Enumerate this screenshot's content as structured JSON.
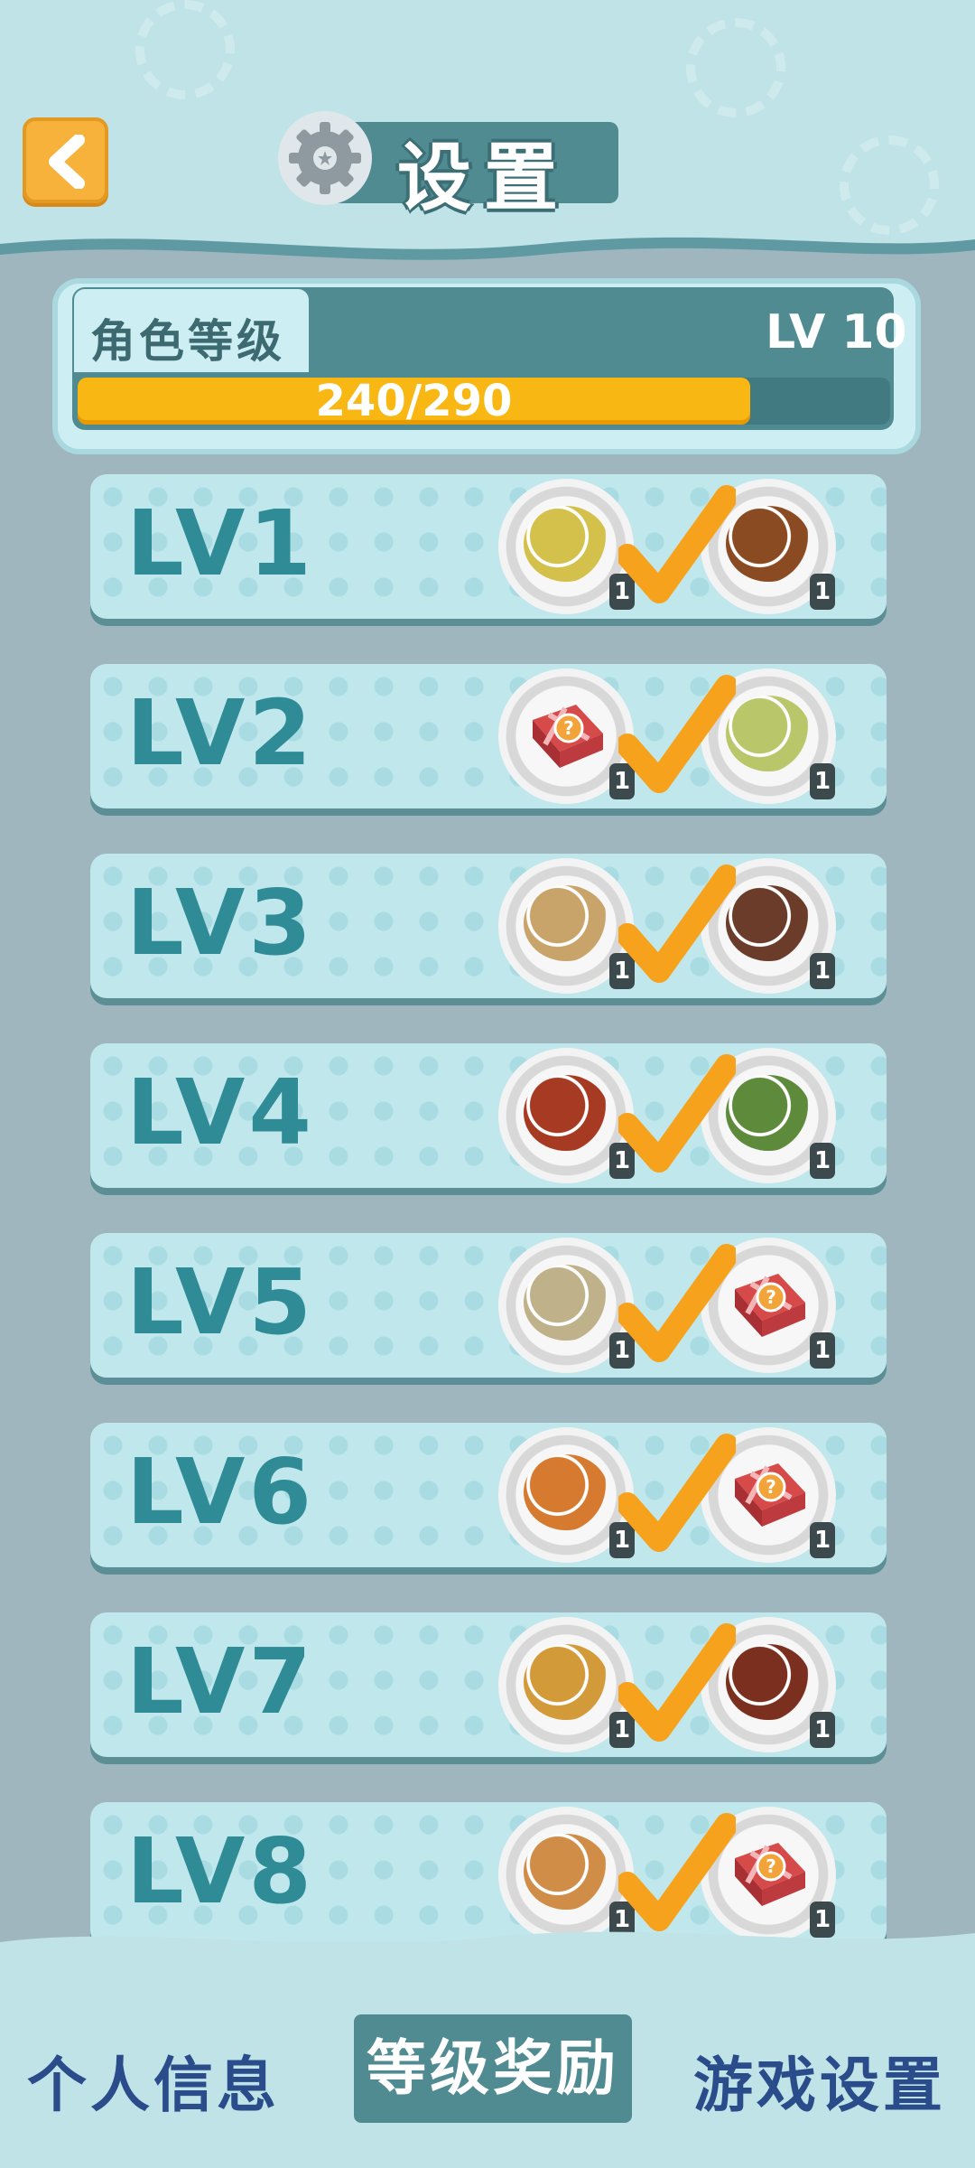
{
  "header": {
    "back_icon": "chevron-left-icon",
    "gear_icon": "gear-icon",
    "title": "设置"
  },
  "level": {
    "role_label": "角色等级",
    "level_text": "LV 10",
    "progress_text": "240/290",
    "progress_fraction": 0.8276
  },
  "rewards": [
    {
      "label": "LV1",
      "left": {
        "kind": "dish",
        "color": "#d4c14b",
        "count": "1"
      },
      "right": {
        "kind": "dish",
        "color": "#8a4a22",
        "count": "1"
      }
    },
    {
      "label": "LV2",
      "left": {
        "kind": "gift",
        "count": "1"
      },
      "right": {
        "kind": "dish",
        "color": "#b9c66a",
        "count": "1"
      }
    },
    {
      "label": "LV3",
      "left": {
        "kind": "dish",
        "color": "#c9a46a",
        "count": "1"
      },
      "right": {
        "kind": "dish",
        "color": "#6b3c2a",
        "count": "1"
      }
    },
    {
      "label": "LV4",
      "left": {
        "kind": "dish",
        "color": "#a63a22",
        "count": "1"
      },
      "right": {
        "kind": "dish",
        "color": "#5e8a3c",
        "count": "1"
      }
    },
    {
      "label": "LV5",
      "left": {
        "kind": "dish",
        "color": "#bfb28a",
        "count": "1"
      },
      "right": {
        "kind": "gift",
        "count": "1"
      }
    },
    {
      "label": "LV6",
      "left": {
        "kind": "dish",
        "color": "#d67a2f",
        "count": "1"
      },
      "right": {
        "kind": "gift",
        "count": "1"
      }
    },
    {
      "label": "LV7",
      "left": {
        "kind": "dish",
        "color": "#d39a3a",
        "count": "1"
      },
      "right": {
        "kind": "dish",
        "color": "#7a2f1f",
        "count": "1"
      }
    },
    {
      "label": "LV8",
      "left": {
        "kind": "dish",
        "color": "#cf8d48",
        "count": "1"
      },
      "right": {
        "kind": "gift",
        "count": "1"
      }
    }
  ],
  "tabs": [
    {
      "label": "个人信息",
      "active": false
    },
    {
      "label": "等级奖励",
      "active": true
    },
    {
      "label": "游戏设置",
      "active": false
    }
  ],
  "colors": {
    "accent": "#f8b712",
    "teal": "#4f8b91",
    "check": "#f7a21c"
  }
}
